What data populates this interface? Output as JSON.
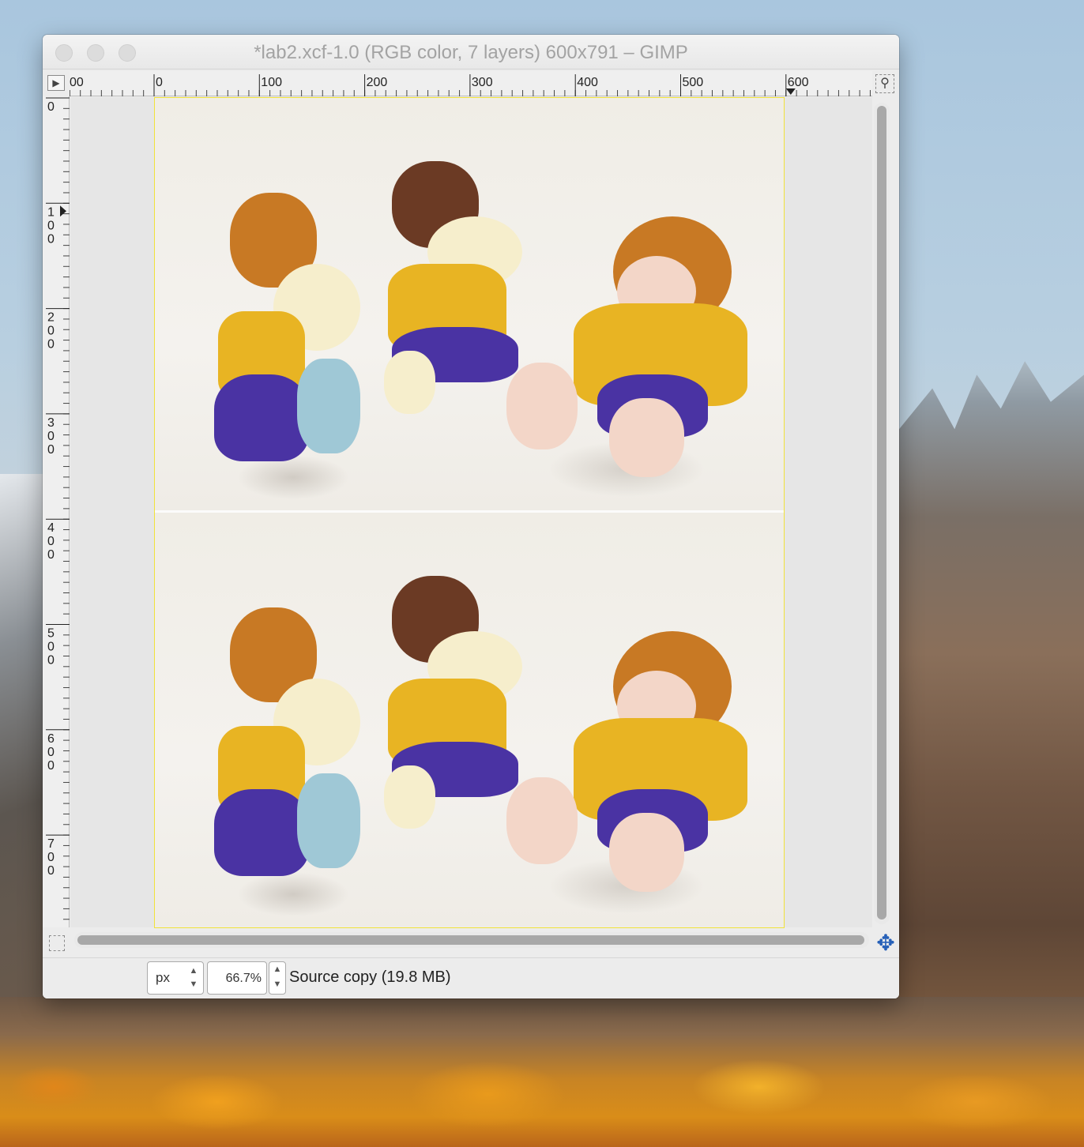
{
  "window": {
    "title": "*lab2.xcf-1.0 (RGB color, 7 layers) 600x791 – GIMP"
  },
  "icons": {
    "menu": "menu-arrow-icon",
    "navigate": "navigate-icon",
    "quickmask": "quick-mask-icon",
    "move": "move-arrows-icon"
  },
  "hruler": {
    "labels": [
      "00",
      "0",
      "100",
      "200",
      "300",
      "400",
      "500",
      "600"
    ]
  },
  "vruler": {
    "labels": [
      "0",
      "100",
      "200",
      "300",
      "400",
      "500",
      "600",
      "700"
    ]
  },
  "status": {
    "unit": "px",
    "zoom": "66.7%",
    "message": "Source copy (19.8 MB)"
  },
  "colors": {
    "selection_dash": "#f1e23a",
    "nav_accent": "#2660b8"
  }
}
